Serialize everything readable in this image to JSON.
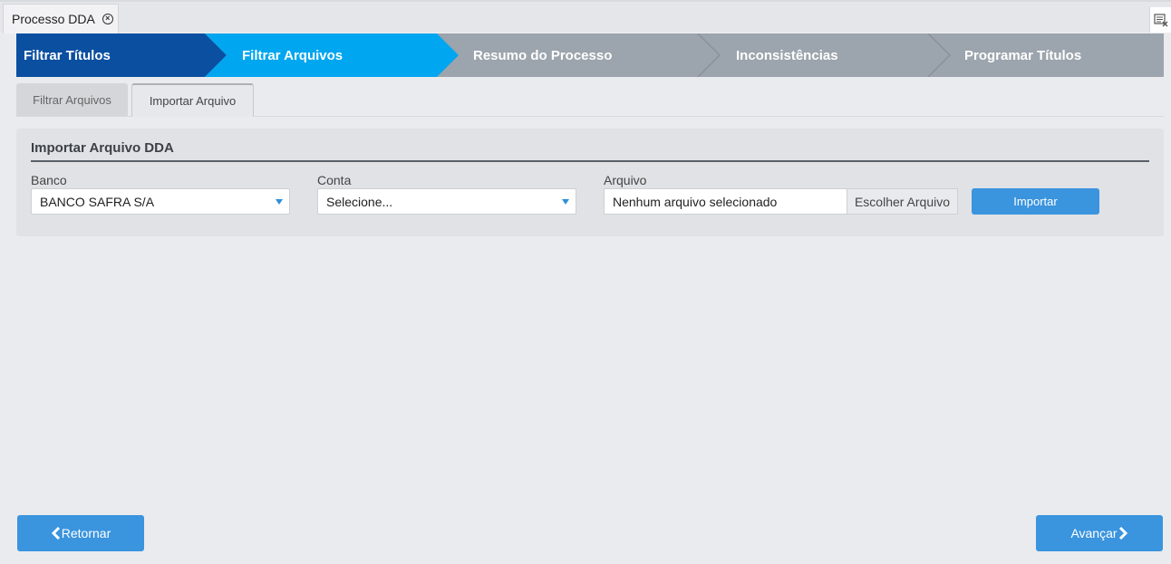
{
  "window_tab": {
    "title": "Processo DDA",
    "close_icon": "close-circle-icon"
  },
  "corner_icon": "window-settings-icon",
  "wizard": {
    "steps": [
      {
        "label": "Filtrar Títulos",
        "state": "completed",
        "color": "#0b4fa1"
      },
      {
        "label": "Filtrar Arquivos",
        "state": "current",
        "color": "#00a6ef"
      },
      {
        "label": "Resumo do Processo",
        "state": "pending",
        "color": "#9ca4ad"
      },
      {
        "label": "Inconsistências",
        "state": "pending",
        "color": "#9ca4ad"
      },
      {
        "label": "Programar Títulos",
        "state": "pending",
        "color": "#9ca4ad"
      }
    ]
  },
  "inner_tabs": [
    {
      "label": "Filtrar Arquivos",
      "active": false
    },
    {
      "label": "Importar Arquivo",
      "active": true
    }
  ],
  "panel": {
    "title": "Importar Arquivo DDA",
    "banco": {
      "label": "Banco",
      "value": "BANCO SAFRA S/A"
    },
    "conta": {
      "label": "Conta",
      "value": "Selecione..."
    },
    "arquivo": {
      "label": "Arquivo",
      "value": "Nenhum arquivo selecionado",
      "button": "Escolher Arquivo"
    },
    "import_button": "Importar"
  },
  "footer": {
    "back_label": "Retornar",
    "next_label": "Avançar"
  },
  "colors": {
    "accent": "#3a94de",
    "step_done": "#0b4fa1",
    "step_current": "#00a6ef",
    "step_pending": "#9ca4ad"
  }
}
